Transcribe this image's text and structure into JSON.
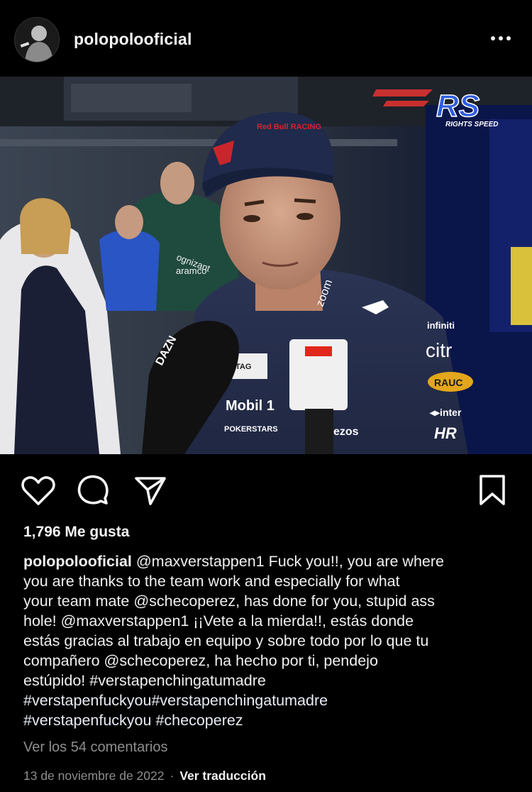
{
  "post": {
    "username": "polopolooficial",
    "more_icon": "more-horizontal-icon"
  },
  "media": {
    "watermark_text": "RIGHTS SPEED",
    "logo_text": "RS",
    "mic_left_text": "DAZN",
    "helmet_sponsor": "Red Bull RACING",
    "shirt_sponsors": [
      "TAG HEUER",
      "Mobil 1",
      "POKERSTARS",
      "ezos",
      "infiniti",
      "citrix",
      "RAUCH",
      "inter",
      "HR",
      "zoom",
      "cognizant",
      "aramco"
    ],
    "progress": 0.95
  },
  "actions": {
    "like_icon": "heart-icon",
    "comment_icon": "comment-icon",
    "share_icon": "send-icon",
    "save_icon": "bookmark-icon"
  },
  "likes_text": "1,796 Me gusta",
  "caption": {
    "user": "polopolooficial",
    "line_1": "@maxverstappen1 Fuck you!!, you are where",
    "line_2": "you are thanks to the team work and especially for what",
    "line_3": "your team mate @schecoperez, has done for you, stupid ass",
    "line_4": "hole! @maxverstappen1 ¡¡Vete a la mierda!!, estás donde",
    "line_5": "estás gracias al trabajo en equipo y sobre todo por lo que tu",
    "line_6": "compañero @schecoperez, ha hecho por ti, pendejo",
    "line_7": "estúpido!  #verstapenchingatumadre",
    "line_8": "#verstapenfuckyou#verstapenchingatumadre",
    "line_9": "#verstapenfuckyou #checoperez"
  },
  "comments_link": "Ver los 54 comentarios",
  "date": "13 de noviembre de 2022",
  "separator": "·",
  "translate_link": "Ver traducción"
}
